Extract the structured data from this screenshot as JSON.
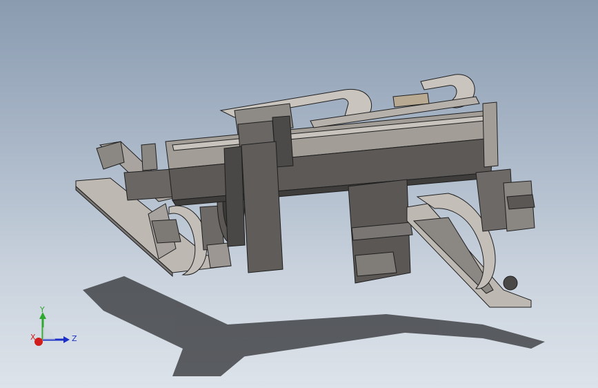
{
  "viewport": {
    "background_top": "#8a9bb0",
    "background_bottom": "#dde3ea"
  },
  "model": {
    "icon": "gantry-robot-3d-model",
    "body_color": "#5c5957",
    "edge_color": "#1e1e1e",
    "light_color": "#bdb8b2",
    "shadow_color": "#2f3033"
  },
  "triad": {
    "x_label": "X",
    "y_label": "Y",
    "z_label": "Z",
    "x_color": "#d01c1c",
    "y_color": "#2fa82f",
    "z_color": "#1c2fc8"
  }
}
